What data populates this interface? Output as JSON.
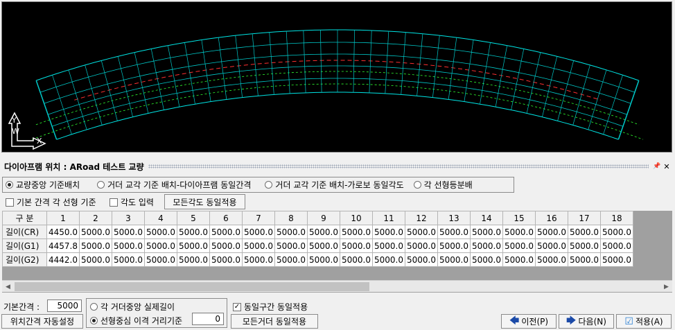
{
  "panel": {
    "title": "다이아프램 위치 : ARoad 테스트 교량"
  },
  "header_buttons": {
    "pin": "📌",
    "close": "✕"
  },
  "placement_options": [
    {
      "label": "교량중앙 기준배치",
      "selected": true
    },
    {
      "label": "거더 교각 기준 배치-다이아프램 동일간격",
      "selected": false
    },
    {
      "label": "거더 교각 기준 배치-가로보 동일각도",
      "selected": false
    },
    {
      "label": "각 선형등분배",
      "selected": false
    }
  ],
  "options2": {
    "base_interval_check": "기본 간격 각 선형 기준",
    "angle_input_check": "각도 입력",
    "apply_all_angle_button": "모든각도 동일적용"
  },
  "table": {
    "corner": "구 분",
    "columns": [
      "1",
      "2",
      "3",
      "4",
      "5",
      "6",
      "7",
      "8",
      "9",
      "10",
      "11",
      "12",
      "13",
      "14",
      "15",
      "16",
      "17",
      "18"
    ],
    "rows": [
      {
        "label": "길이(CR)",
        "values": [
          "4450.0",
          "5000.0",
          "5000.0",
          "5000.0",
          "5000.0",
          "5000.0",
          "5000.0",
          "5000.0",
          "5000.0",
          "5000.0",
          "5000.0",
          "5000.0",
          "5000.0",
          "5000.0",
          "5000.0",
          "5000.0",
          "5000.0",
          "5000.0"
        ]
      },
      {
        "label": "길이(G1)",
        "values": [
          "4457.8",
          "5000.0",
          "5000.0",
          "5000.0",
          "5000.0",
          "5000.0",
          "5000.0",
          "5000.0",
          "5000.0",
          "5000.0",
          "5000.0",
          "5000.0",
          "5000.0",
          "5000.0",
          "5000.0",
          "5000.0",
          "5000.0",
          "5000.0"
        ]
      },
      {
        "label": "길이(G2)",
        "values": [
          "4442.0",
          "5000.0",
          "5000.0",
          "5000.0",
          "5000.0",
          "5000.0",
          "5000.0",
          "5000.0",
          "5000.0",
          "5000.0",
          "5000.0",
          "5000.0",
          "5000.0",
          "5000.0",
          "5000.0",
          "5000.0",
          "5000.0",
          "5000.0"
        ]
      }
    ]
  },
  "bottom": {
    "base_interval_label": "기본간격 :",
    "base_interval_value": "5000",
    "auto_position_button": "위치간격 자동설정",
    "girder_center_radio": "각 거더중앙 실제길이",
    "alignment_center_radio": "선형중심 이격 거리기준",
    "alignment_offset_value": "0",
    "same_section_check": "동일구간 동일적용",
    "apply_all_girder_button": "모든거더 동일적용",
    "prev_button": "이전(P)",
    "next_button": "다음(N)",
    "apply_button": "적용(A)"
  },
  "axis": {
    "y": "Y",
    "w": "W",
    "x": "X"
  },
  "colors": {
    "viewport_bg": "#000000",
    "bridge_outline": "#00e5e5",
    "girder_lines": "#00c8c8",
    "centerline": "#ff3030",
    "alignment": "#30ff30",
    "accent_blue": "#1b4aa8"
  }
}
